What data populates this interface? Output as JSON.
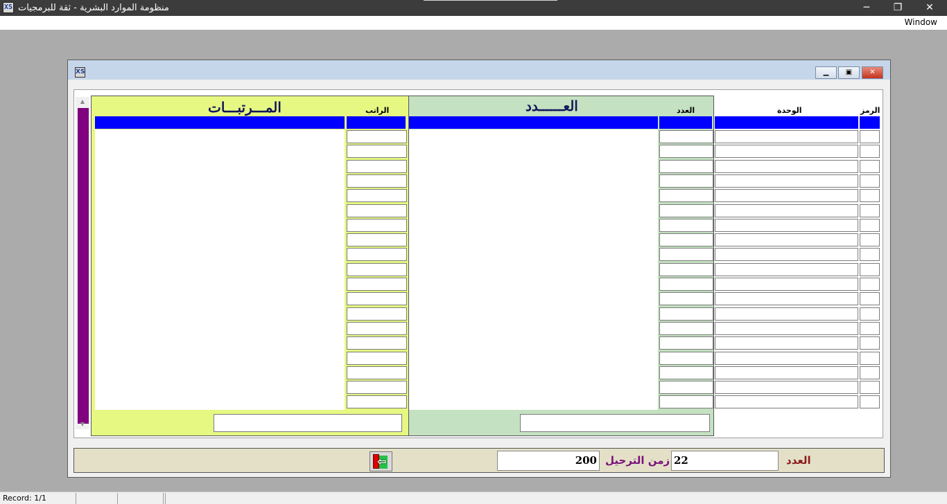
{
  "app": {
    "title": "منظومة الموارد البشرية - ثقة للبرمجيات",
    "minimize_glyph": "─",
    "restore_glyph": "❐",
    "close_glyph": "✕"
  },
  "menubar": {
    "window": "Window"
  },
  "form": {
    "minimize": "▁",
    "restore": "▣",
    "close": "✕"
  },
  "headers": {
    "code": "الرمز",
    "unit": "الوحدة",
    "count": "العدد",
    "salary": "الراتب",
    "count_group": "العــــــدد",
    "salaries_group": "المـــرتبـــات"
  },
  "grid": {
    "row_count": 19
  },
  "totals": {
    "count_total": "",
    "salaries_total": ""
  },
  "footer": {
    "count_label": "العدد",
    "count_value": "22",
    "posting_time_label": "زمن الترحيل",
    "posting_time_value": "200",
    "exit_icon": "exit-door-icon"
  },
  "status_bar": {
    "record": "Record: 1/1"
  },
  "colors": {
    "selected_row": "#0000ff",
    "salaries_panel": "#e6f882",
    "count_panel": "#c4e1c1",
    "scroll_thumb": "#800080",
    "footer_band": "#e3e0c7"
  }
}
